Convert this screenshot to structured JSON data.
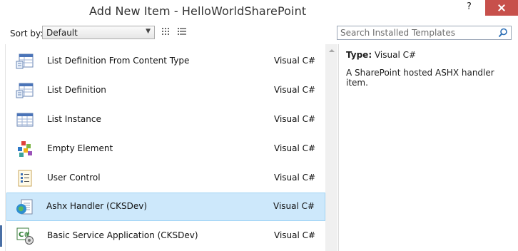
{
  "window": {
    "title": "Add New Item - HelloWorldSharePoint",
    "help_label": "?"
  },
  "toolbar": {
    "sort_label": "Sort by:",
    "sort_value": "Default",
    "search_placeholder": "Search Installed Templates"
  },
  "templates": [
    {
      "name": "List Definition From Content Type",
      "lang": "Visual C#",
      "icon": "list-definition-content-type-icon"
    },
    {
      "name": "List Definition",
      "lang": "Visual C#",
      "icon": "list-definition-icon"
    },
    {
      "name": "List Instance",
      "lang": "Visual C#",
      "icon": "list-instance-icon"
    },
    {
      "name": "Empty Element",
      "lang": "Visual C#",
      "icon": "empty-element-icon"
    },
    {
      "name": "User Control",
      "lang": "Visual C#",
      "icon": "user-control-icon"
    },
    {
      "name": "Ashx Handler (CKSDev)",
      "lang": "Visual C#",
      "icon": "ashx-handler-icon",
      "selected": true
    },
    {
      "name": "Basic Service Application (CKSDev)",
      "lang": "Visual C#",
      "icon": "service-application-icon"
    }
  ],
  "info": {
    "type_label": "Type:",
    "type_value": "Visual C#",
    "description": "A SharePoint hosted ASHX handler item."
  },
  "colors": {
    "selection": "#cde8fb",
    "close_button": "#c7504b"
  }
}
